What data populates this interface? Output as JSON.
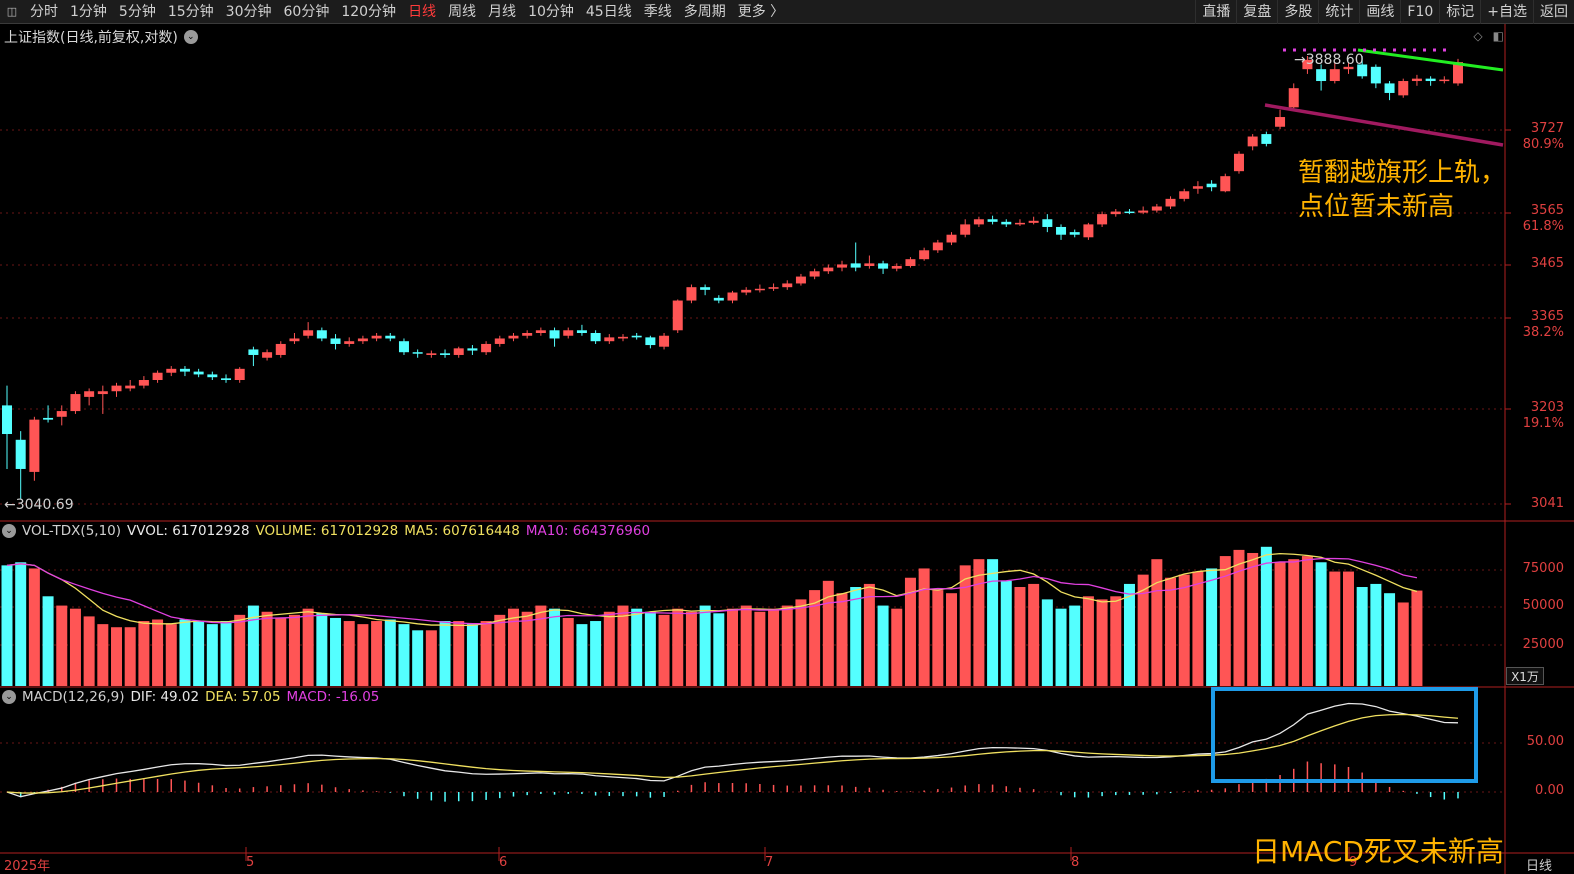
{
  "toolbar": {
    "left_items": [
      "分时",
      "1分钟",
      "5分钟",
      "15分钟",
      "30分钟",
      "60分钟",
      "120分钟",
      "日线",
      "周线",
      "月线",
      "10分钟",
      "45日线",
      "季线",
      "多周期",
      "更多 〉"
    ],
    "active_item": "日线",
    "right_items": [
      "直播",
      "复盘",
      "多股",
      "统计",
      "画线",
      "F10",
      "标记",
      "+自选",
      "返回"
    ]
  },
  "price_panel": {
    "title": "上证指数(日线,前复权,对数)",
    "low_label": "←3040.69",
    "high_label": "→3888.60",
    "axis_prices": [
      "3727",
      "3565",
      "3465",
      "3365",
      "3203",
      "3041"
    ],
    "axis_pcts": [
      "80.9%",
      "61.8%",
      "38.2%",
      "19.1%"
    ]
  },
  "volume_panel": {
    "name": "VOL-TDX(5,10)",
    "vvol": "VVOL: 617012928",
    "volume": "VOLUME: 617012928",
    "ma5": "MA5: 607616448",
    "ma10": "MA10: 664376960",
    "axis": [
      "75000",
      "50000",
      "25000"
    ],
    "unit": "X1万"
  },
  "macd_panel": {
    "name": "MACD(12,26,9)",
    "dif": "DIF: 49.02",
    "dea": "DEA: 57.05",
    "macd": "MACD: -16.05",
    "axis": [
      "50.00",
      "0.00"
    ]
  },
  "x_axis": {
    "labels": [
      "2025年",
      "5",
      "6",
      "7",
      "8",
      "9"
    ],
    "period": "日线"
  },
  "annotations": {
    "flag_line1": "暂翻越旗形上轨，",
    "flag_line2": "点位暂未新高",
    "macd_note": "日MACD死叉未新高"
  },
  "colors": {
    "up": "#ff5555",
    "down": "#54ffff",
    "ma5": "#f0e060",
    "ma10": "#e040e0",
    "flag_top": "#22ee22",
    "flag_bottom": "#a01a60",
    "box": "#1e9be8",
    "annotation": "#ffb300"
  },
  "chart_data": {
    "type": "candlestick",
    "candles": [
      [
        3210,
        3160,
        3245,
        3100,
        "down"
      ],
      [
        3150,
        3100,
        3165,
        3050,
        "down"
      ],
      [
        3095,
        3185,
        3190,
        3080,
        "up"
      ],
      [
        3185,
        3188,
        3210,
        3180,
        "down"
      ],
      [
        3190,
        3200,
        3210,
        3175,
        "up"
      ],
      [
        3200,
        3230,
        3235,
        3195,
        "up"
      ],
      [
        3225,
        3235,
        3240,
        3210,
        "up"
      ],
      [
        3230,
        3235,
        3245,
        3195,
        "up"
      ],
      [
        3235,
        3245,
        3250,
        3225,
        "up"
      ],
      [
        3240,
        3245,
        3255,
        3235,
        "up"
      ],
      [
        3245,
        3255,
        3262,
        3240,
        "up"
      ],
      [
        3255,
        3268,
        3272,
        3250,
        "up"
      ],
      [
        3268,
        3275,
        3280,
        3262,
        "up"
      ],
      [
        3275,
        3270,
        3280,
        3262,
        "down"
      ],
      [
        3270,
        3265,
        3275,
        3260,
        "down"
      ],
      [
        3265,
        3260,
        3270,
        3255,
        "down"
      ],
      [
        3258,
        3255,
        3265,
        3250,
        "down"
      ],
      [
        3255,
        3275,
        3278,
        3250,
        "up"
      ],
      [
        3310,
        3300,
        3315,
        3280,
        "down"
      ],
      [
        3295,
        3305,
        3310,
        3290,
        "up"
      ],
      [
        3300,
        3320,
        3325,
        3295,
        "up"
      ],
      [
        3325,
        3330,
        3340,
        3320,
        "up"
      ],
      [
        3335,
        3345,
        3360,
        3330,
        "up"
      ],
      [
        3345,
        3330,
        3350,
        3325,
        "down"
      ],
      [
        3330,
        3320,
        3338,
        3310,
        "down"
      ],
      [
        3320,
        3325,
        3332,
        3315,
        "up"
      ],
      [
        3325,
        3330,
        3335,
        3320,
        "up"
      ],
      [
        3330,
        3335,
        3340,
        3325,
        "up"
      ],
      [
        3335,
        3330,
        3340,
        3325,
        "down"
      ],
      [
        3325,
        3305,
        3330,
        3300,
        "down"
      ],
      [
        3305,
        3303,
        3310,
        3295,
        "down"
      ],
      [
        3300,
        3303,
        3308,
        3295,
        "up"
      ],
      [
        3303,
        3300,
        3310,
        3295,
        "down"
      ],
      [
        3300,
        3312,
        3315,
        3295,
        "up"
      ],
      [
        3312,
        3308,
        3318,
        3300,
        "down"
      ],
      [
        3305,
        3320,
        3325,
        3300,
        "up"
      ],
      [
        3320,
        3330,
        3335,
        3315,
        "up"
      ],
      [
        3330,
        3335,
        3340,
        3325,
        "up"
      ],
      [
        3335,
        3340,
        3345,
        3330,
        "up"
      ],
      [
        3340,
        3345,
        3350,
        3335,
        "up"
      ],
      [
        3345,
        3330,
        3350,
        3315,
        "down"
      ],
      [
        3335,
        3345,
        3350,
        3330,
        "up"
      ],
      [
        3345,
        3340,
        3355,
        3335,
        "down"
      ],
      [
        3340,
        3325,
        3345,
        3320,
        "down"
      ],
      [
        3325,
        3332,
        3338,
        3320,
        "up"
      ],
      [
        3330,
        3333,
        3338,
        3325,
        "up"
      ],
      [
        3335,
        3332,
        3340,
        3328,
        "down"
      ],
      [
        3332,
        3318,
        3335,
        3312,
        "down"
      ],
      [
        3315,
        3335,
        3340,
        3310,
        "up"
      ],
      [
        3345,
        3400,
        3402,
        3340,
        "up"
      ],
      [
        3400,
        3425,
        3430,
        3395,
        "up"
      ],
      [
        3425,
        3420,
        3430,
        3410,
        "down"
      ],
      [
        3405,
        3400,
        3410,
        3395,
        "down"
      ],
      [
        3400,
        3415,
        3418,
        3395,
        "up"
      ],
      [
        3415,
        3420,
        3425,
        3410,
        "up"
      ],
      [
        3420,
        3422,
        3430,
        3415,
        "up"
      ],
      [
        3422,
        3425,
        3432,
        3418,
        "up"
      ],
      [
        3425,
        3432,
        3438,
        3420,
        "up"
      ],
      [
        3432,
        3445,
        3450,
        3428,
        "up"
      ],
      [
        3445,
        3455,
        3460,
        3440,
        "up"
      ],
      [
        3455,
        3462,
        3468,
        3450,
        "up"
      ],
      [
        3462,
        3468,
        3475,
        3455,
        "up"
      ],
      [
        3470,
        3462,
        3510,
        3455,
        "down"
      ],
      [
        3465,
        3470,
        3485,
        3460,
        "up"
      ],
      [
        3470,
        3460,
        3475,
        3450,
        "down"
      ],
      [
        3460,
        3465,
        3470,
        3455,
        "up"
      ],
      [
        3465,
        3478,
        3482,
        3462,
        "up"
      ],
      [
        3478,
        3495,
        3500,
        3475,
        "up"
      ],
      [
        3495,
        3510,
        3515,
        3490,
        "up"
      ],
      [
        3510,
        3525,
        3530,
        3505,
        "up"
      ],
      [
        3525,
        3545,
        3555,
        3520,
        "up"
      ],
      [
        3545,
        3555,
        3560,
        3540,
        "up"
      ],
      [
        3555,
        3550,
        3562,
        3545,
        "down"
      ],
      [
        3550,
        3545,
        3555,
        3540,
        "down"
      ],
      [
        3545,
        3548,
        3555,
        3542,
        "up"
      ],
      [
        3548,
        3552,
        3560,
        3545,
        "up"
      ],
      [
        3555,
        3540,
        3565,
        3530,
        "down"
      ],
      [
        3540,
        3525,
        3545,
        3515,
        "down"
      ],
      [
        3525,
        3530,
        3535,
        3520,
        "down"
      ],
      [
        3520,
        3545,
        3548,
        3515,
        "up"
      ],
      [
        3545,
        3565,
        3570,
        3540,
        "up"
      ],
      [
        3565,
        3570,
        3575,
        3560,
        "up"
      ],
      [
        3570,
        3568,
        3575,
        3565,
        "down"
      ],
      [
        3568,
        3572,
        3580,
        3565,
        "up"
      ],
      [
        3572,
        3580,
        3585,
        3568,
        "up"
      ],
      [
        3580,
        3595,
        3600,
        3575,
        "up"
      ],
      [
        3595,
        3610,
        3615,
        3590,
        "up"
      ],
      [
        3615,
        3620,
        3630,
        3605,
        "up"
      ],
      [
        3625,
        3618,
        3632,
        3610,
        "down"
      ],
      [
        3610,
        3640,
        3645,
        3608,
        "up"
      ],
      [
        3650,
        3685,
        3690,
        3645,
        "up"
      ],
      [
        3700,
        3720,
        3725,
        3692,
        "up"
      ],
      [
        3725,
        3705,
        3730,
        3700,
        "down"
      ],
      [
        3740,
        3760,
        3775,
        3735,
        "up"
      ],
      [
        3780,
        3820,
        3830,
        3775,
        "up"
      ],
      [
        3860,
        3880,
        3888,
        3850,
        "up"
      ],
      [
        3860,
        3835,
        3870,
        3815,
        "down"
      ],
      [
        3835,
        3860,
        3875,
        3830,
        "up"
      ],
      [
        3860,
        3865,
        3875,
        3850,
        "up"
      ],
      [
        3870,
        3845,
        3888,
        3840,
        "down"
      ],
      [
        3865,
        3830,
        3870,
        3820,
        "down"
      ],
      [
        3830,
        3810,
        3835,
        3795,
        "down"
      ],
      [
        3805,
        3835,
        3840,
        3800,
        "up"
      ],
      [
        3835,
        3840,
        3848,
        3825,
        "up"
      ],
      [
        3840,
        3835,
        3845,
        3825,
        "down"
      ],
      [
        3835,
        3838,
        3845,
        3830,
        "up"
      ],
      [
        3830,
        3875,
        3882,
        3825,
        "up"
      ]
    ],
    "volume": [
      78000,
      80000,
      76000,
      58000,
      52000,
      50000,
      45000,
      40000,
      38000,
      38000,
      42000,
      43000,
      40000,
      43000,
      42000,
      40000,
      42000,
      46000,
      52000,
      48000,
      44000,
      46000,
      50000,
      47000,
      44000,
      42000,
      40000,
      42000,
      43000,
      40000,
      36000,
      36000,
      42000,
      42000,
      40000,
      42000,
      46000,
      50000,
      48000,
      52000,
      50000,
      44000,
      40000,
      42000,
      48000,
      52000,
      50000,
      48000,
      46000,
      50000,
      48000,
      52000,
      47000,
      50000,
      52000,
      48000,
      50000,
      52000,
      56000,
      62000,
      68000,
      60000,
      64000,
      66000,
      52000,
      50000,
      70000,
      76000,
      62000,
      60000,
      78000,
      82000,
      82000,
      68000,
      64000,
      66000,
      56000,
      50000,
      52000,
      58000,
      56000,
      58000,
      66000,
      72000,
      82000,
      70000,
      72000,
      74000,
      76000,
      84000,
      88000,
      86000,
      90000,
      80000,
      82000,
      84000,
      80000,
      74000,
      74000,
      64000,
      66000,
      60000,
      54000,
      61701
    ],
    "macd_note": "DIF 49.02, DEA 57.05, MACD -16.05"
  }
}
